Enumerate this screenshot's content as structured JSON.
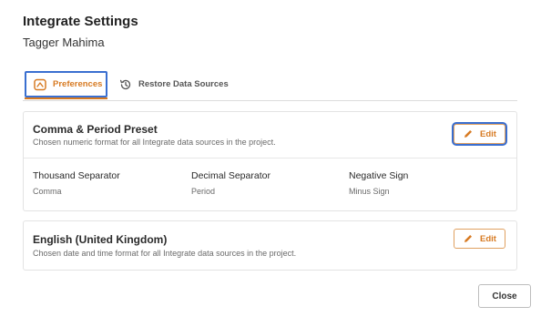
{
  "dialog": {
    "title": "Integrate Settings",
    "subtitle": "Tagger Mahima"
  },
  "tabs": [
    {
      "label": "Preferences",
      "icon": "preferences-icon",
      "active": true
    },
    {
      "label": "Restore Data Sources",
      "icon": "history-icon",
      "active": false
    }
  ],
  "number_format": {
    "title": "Comma & Period Preset",
    "description": "Chosen numeric format for all Integrate data sources in the project.",
    "edit_label": "Edit",
    "fields": [
      {
        "label": "Thousand Separator",
        "value": "Comma"
      },
      {
        "label": "Decimal Separator",
        "value": "Period"
      },
      {
        "label": "Negative Sign",
        "value": "Minus Sign"
      }
    ]
  },
  "locale": {
    "title": "English (United Kingdom)",
    "description": "Chosen date and time format for all Integrate data sources in the project.",
    "edit_label": "Edit"
  },
  "footer": {
    "close_label": "Close"
  },
  "colors": {
    "accent": "#d77a22",
    "focus": "#3a6fd0",
    "border": "#e3e3e3"
  }
}
